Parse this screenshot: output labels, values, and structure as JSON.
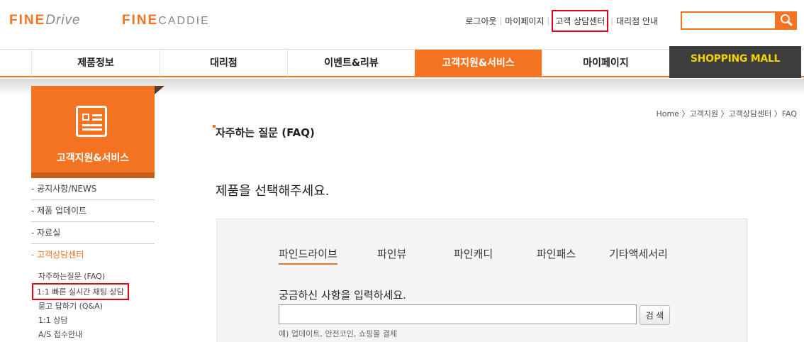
{
  "header": {
    "logos": [
      {
        "fine": "FINE",
        "rest": "Drive"
      },
      {
        "fine": "FINE",
        "rest": "CADDIE"
      }
    ],
    "util_links": [
      "로그아웃",
      "마이페이지",
      "고객 상담센터",
      "대리점 안내"
    ],
    "search": {
      "value": "",
      "placeholder": ""
    }
  },
  "gnb": {
    "items": [
      "제품정보",
      "대리점",
      "이벤트&리뷰",
      "고객지원&서비스",
      "마이페이지"
    ],
    "shop": "SHOPPING MALL"
  },
  "lnb": {
    "title": "고객지원&서비스",
    "menu": [
      "- 공지사항/NEWS",
      "- 제품 업데이트",
      "- 자료실",
      "- 고객상담센터"
    ],
    "sub": [
      "자주하는질문 (FAQ)",
      "1:1 빠른 실시간 채팅 상담",
      "묻고 답하기 (Q&A)",
      "1:1 상담",
      "A/S 접수안내"
    ]
  },
  "content": {
    "breadcrumb": "Home 〉고객지원 〉고객상담센터 〉FAQ",
    "title": "자주하는 질문 (FAQ)",
    "subtitle": "제품을 선택해주세요.",
    "tabs": [
      "파인드라이브",
      "파인뷰",
      "파인캐디",
      "파인패스",
      "기타액세서리"
    ],
    "search_label": "궁금하신 사항을 입력하세요.",
    "search_value": "",
    "search_button": "검 색",
    "search_hint": "예) 업데이트, 안전코인, 쇼핑몰 결제"
  },
  "colors": {
    "accent": "#f47320",
    "highlight": "#e1001c",
    "shop_bg": "#3d3d3d",
    "shop_text": "#f4d200"
  }
}
